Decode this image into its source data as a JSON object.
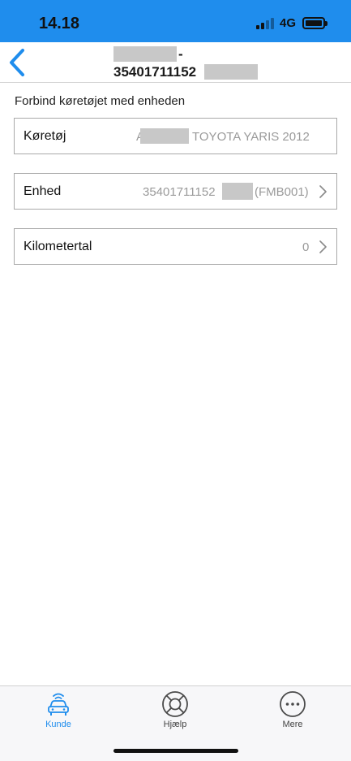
{
  "status_bar": {
    "time": "14.18",
    "network": "4G"
  },
  "nav": {
    "title_line1_suffix": "-",
    "title_line2_prefix": "35401711152"
  },
  "section_label": "Forbind køretøjet med enheden",
  "rows": {
    "vehicle": {
      "label": "Køretøj",
      "value_suffix": "TOYOTA YARIS 2012",
      "value_prefix": "A"
    },
    "device": {
      "label": "Enhed",
      "value_prefix": "35401711152",
      "value_suffix": "(FMB001)"
    },
    "km": {
      "label": "Kilometertal",
      "value": "0"
    }
  },
  "tabs": [
    {
      "label": "Kunde",
      "icon": "car-wifi-icon",
      "active": true
    },
    {
      "label": "Hjælp",
      "icon": "lifebuoy-icon",
      "active": false
    },
    {
      "label": "Mere",
      "icon": "more-dots-icon",
      "active": false
    }
  ],
  "colors": {
    "accent": "#1f8ded",
    "muted_text": "#9a9a9a",
    "border": "#a9a9a9"
  }
}
